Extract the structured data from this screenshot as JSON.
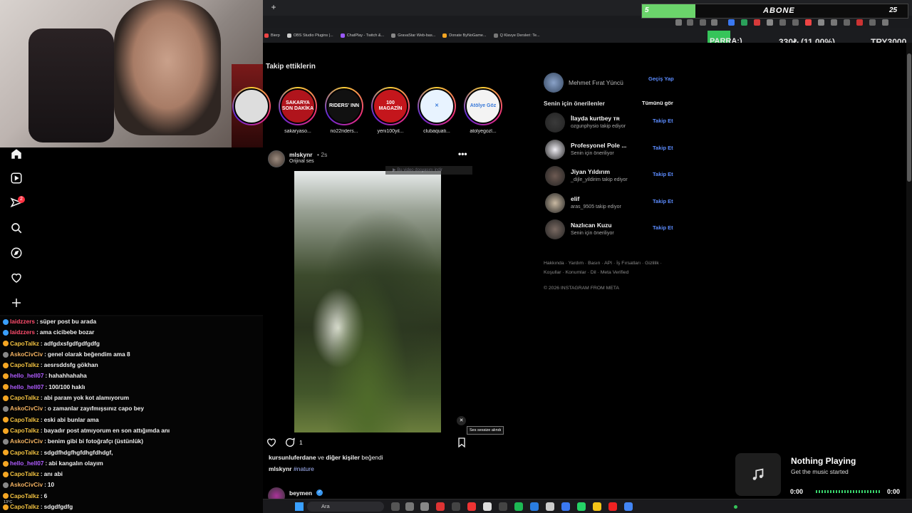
{
  "overlay": {
    "sub_left": "5",
    "sub_label": "ABONE",
    "sub_right": "25",
    "sub_progress": 0.2,
    "parra": "PARRA:)",
    "ticker_value": "330₺ (11.00%)",
    "ticker_currency": "TRY3000"
  },
  "bookmarks": [
    {
      "label": "Bierp",
      "color": "#e44"
    },
    {
      "label": "OBS Studio Plugins |...",
      "color": "#ccc"
    },
    {
      "label": "ChatPlay - Twitch &...",
      "color": "#9b59ff"
    },
    {
      "label": "GravaStar Web-bas...",
      "color": "#888"
    },
    {
      "label": "Donate ByNoGame...",
      "color": "#f5a623"
    },
    {
      "label": "Q Klavye Dersleri: Te...",
      "color": "#777"
    }
  ],
  "nav": {
    "notification_count": "2"
  },
  "feed": {
    "following_title": "Takip ettiklerin",
    "stories": [
      {
        "name": "",
        "logo": "",
        "bg": "#ddd"
      },
      {
        "name": "sakaryaso...",
        "logo": "SAKARYA SON DAKİKA",
        "bg": "#b0141c"
      },
      {
        "name": "no22riders...",
        "logo": "RIDERS' INN",
        "bg": "#111"
      },
      {
        "name": "yeni100yil...",
        "logo": "100 MAGAZİN",
        "bg": "#c4161c"
      },
      {
        "name": "clubaquati...",
        "logo": "✕",
        "bg": "#e8f3ff"
      },
      {
        "name": "atolyegozl...",
        "logo": "Atölye Göz",
        "bg": "#f3f3f3"
      }
    ],
    "post": {
      "user": "mlskynr",
      "time": "• 2s",
      "audio": "Orijinal ses",
      "download_banner": "▶ Bu video dosyasını indir",
      "mute_tooltip": "Ses sessize alındı",
      "comment_count": "1",
      "liked_by_users": "kursunluferdane",
      "liked_by_mid": " ve ",
      "liked_by_others": "diğer kişiler",
      "liked_by_suffix": " beğendi",
      "caption_user": "mlskynr",
      "caption_tag": "#nature"
    },
    "next_post_user": "beymen"
  },
  "sidebar": {
    "self_name": "Mehmet Fırat Yüncü",
    "switch_label": "Geçiş Yap",
    "suggest_title": "Senin için önerilenler",
    "see_all": "Tümünü gör",
    "suggestions": [
      {
        "name": "İlayda kurtbey ᴛʀ",
        "sub": "ozgunphysio takip ediyor",
        "follow": "Takip Et",
        "color": "#3a3a3a"
      },
      {
        "name": "Profesyonel Pole ...",
        "sub": "Senin için öneriliyor",
        "follow": "Takip Et",
        "color": "#f0eef5"
      },
      {
        "name": "Jiyan Yıldırım",
        "sub": "_dijle_yildirim takip ediyor",
        "follow": "Takip Et",
        "color": "#6d5a52"
      },
      {
        "name": "elif",
        "sub": "aras_9505 takip ediyor",
        "follow": "Takip Et",
        "color": "#c9b9a2"
      },
      {
        "name": "Nazlıcan Kuzu",
        "sub": "Senin için öneriliyor",
        "follow": "Takip Et",
        "color": "#7a6a62"
      }
    ],
    "footer": "Hakkında · Yardım · Basın · API · İş Fırsatları · Gizlilik · Koşullar · Konumlar · Dil · Meta Verified",
    "copyright": "© 2026 INSTAGRAM FROM META"
  },
  "chat": [
    {
      "user": "laidzzers",
      "msg": "süper post bu arada",
      "color": "#ff4d6d",
      "badge": "#3aa0ff"
    },
    {
      "user": "laidzzers",
      "msg": "ama cicibebe bozar",
      "color": "#ff4d6d",
      "badge": "#3aa0ff"
    },
    {
      "user": "CapoTalkz",
      "msg": "adfgdxsfgdfgdfgdfg",
      "color": "#f0c040",
      "badge": "#f5a623"
    },
    {
      "user": "AskoCivCiv",
      "msg": "genel olarak beğendim ama 8",
      "color": "#f0b060",
      "badge": "#888"
    },
    {
      "user": "CapoTalkz",
      "msg": "aesrsddsfg gökhan",
      "color": "#f0c040",
      "badge": "#f5a623"
    },
    {
      "user": "hello_hell07",
      "msg": "hahahhahaha",
      "color": "#b05cff",
      "badge": "#f5a623"
    },
    {
      "user": "hello_hell07",
      "msg": "100/100 haklı",
      "color": "#b05cff",
      "badge": "#f5a623"
    },
    {
      "user": "CapoTalkz",
      "msg": "abi param yok kot alamıyorum",
      "color": "#f0c040",
      "badge": "#f5a623"
    },
    {
      "user": "AskoCivCiv",
      "msg": "o zamanlar zayıfmışsınız capo bey",
      "color": "#f0b060",
      "badge": "#888"
    },
    {
      "user": "CapoTalkz",
      "msg": "eski abi bunlar ama",
      "color": "#f0c040",
      "badge": "#f5a623"
    },
    {
      "user": "CapoTalkz",
      "msg": "bayadır post atmıyorum en son attığımda anı",
      "color": "#f0c040",
      "badge": "#f5a623"
    },
    {
      "user": "AskoCivCiv",
      "msg": "benim gibi bi fotoğrafçı (üstünlük)",
      "color": "#f0b060",
      "badge": "#888"
    },
    {
      "user": "CapoTalkz",
      "msg": "sdgdfhdgfhgfdhgfdhdgf,",
      "color": "#f0c040",
      "badge": "#f5a623"
    },
    {
      "user": "hello_hell07",
      "msg": "abi kangalın olayım",
      "color": "#b05cff",
      "badge": "#f5a623"
    },
    {
      "user": "CapoTalkz",
      "msg": "anı abi",
      "color": "#f0c040",
      "badge": "#f5a623"
    },
    {
      "user": "AskoCivCiv",
      "msg": "10",
      "color": "#f0b060",
      "badge": "#888"
    },
    {
      "user": "CapoTalkz",
      "msg": "6",
      "color": "#f0c040",
      "badge": "#f5a623"
    },
    {
      "user": "CapoTalkz",
      "msg": "sdgdfgdfg",
      "color": "#f0c040",
      "badge": "#f5a623"
    }
  ],
  "music": {
    "title": "Nothing Playing",
    "subtitle": "Get the music started",
    "time_start": "0:00",
    "time_end": "0:00"
  },
  "taskbar": {
    "search_label": "Ara",
    "weather": "13°C"
  }
}
